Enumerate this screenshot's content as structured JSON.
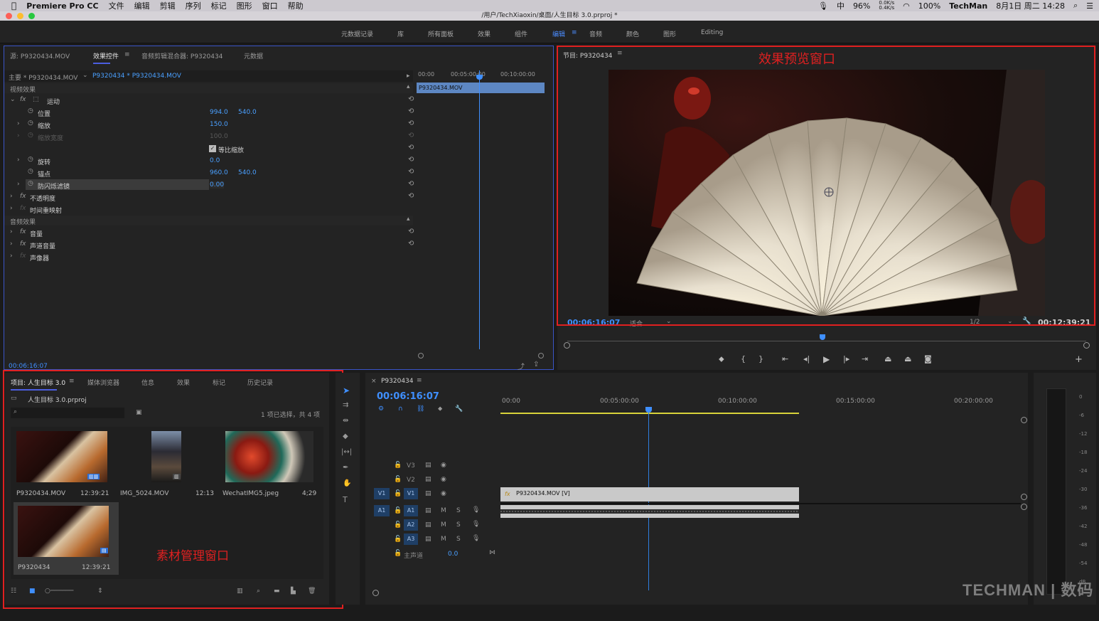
{
  "menubar": {
    "apple": "",
    "items": [
      "Premiere Pro CC",
      "文件",
      "编辑",
      "剪辑",
      "序列",
      "标记",
      "图形",
      "窗口",
      "帮助"
    ],
    "status": {
      "input": "中",
      "battery": "96%",
      "net_up": "0.0K/s",
      "net_down": "0.4K/s",
      "volume": "100%",
      "user": "TechMan",
      "datetime": "8月1日 周二 14:28"
    }
  },
  "titlebar": {
    "path": "/用户/TechXiaoxin/桌面/人生目标 3.0.prproj *"
  },
  "workspaces": [
    "元数据记录",
    "库",
    "所有面板",
    "效果",
    "组件",
    "编辑",
    "音频",
    "颜色",
    "图形",
    "Editing"
  ],
  "effect_controls": {
    "tabs": [
      "源: P9320434.MOV",
      "效果控件",
      "音频剪辑混合器: P9320434",
      "元数据"
    ],
    "header_left": "主要 * P9320434.MOV",
    "header_right": "P9320434 * P9320434.MOV",
    "mini_ruler": [
      "00:00",
      "00:05:00:00",
      "00:10:00:00"
    ],
    "mini_clip": "P9320434.MOV",
    "video_effects_label": "视频效果",
    "motion": "运动",
    "props": [
      {
        "name": "位置",
        "v1": "994.0",
        "v2": "540.0"
      },
      {
        "name": "缩放",
        "v1": "150.0",
        "v2": ""
      },
      {
        "name": "缩放宽度",
        "v1": "100.0",
        "v2": ""
      },
      {
        "name": "等比缩放",
        "v1": "",
        "v2": ""
      },
      {
        "name": "旋转",
        "v1": "0.0",
        "v2": ""
      },
      {
        "name": "锚点",
        "v1": "960.0",
        "v2": "540.0"
      },
      {
        "name": "防闪烁滤镜",
        "v1": "0.00",
        "v2": ""
      }
    ],
    "opacity": "不透明度",
    "time_remap": "时间重映射",
    "audio_effects_label": "音频效果",
    "audio_items": [
      "音量",
      "声道音量",
      "声像器"
    ],
    "timecode": "00:06:16:07"
  },
  "program_monitor": {
    "title": "节目: P9320434",
    "annotation": "效果预览窗口",
    "timecode": "00:06:16:07",
    "fit": "适合",
    "quality": "1/2",
    "duration": "00:12:39:21"
  },
  "project_panel": {
    "tabs": [
      "项目: 人生目标 3.0",
      "媒体浏览器",
      "信息",
      "效果",
      "标记",
      "历史记录"
    ],
    "project_file": "人生目标 3.0.prproj",
    "selection_info": "1 项已选择，共 4 项",
    "annotation": "素材管理窗口",
    "items": [
      {
        "name": "P9320434.MOV",
        "duration": "12:39:21"
      },
      {
        "name": "IMG_5024.MOV",
        "duration": "12:13"
      },
      {
        "name": "WechatIMG5.jpeg",
        "duration": "4;29"
      },
      {
        "name": "P9320434",
        "duration": "12:39:21"
      }
    ]
  },
  "timeline": {
    "title": "P9320434",
    "timecode": "00:06:16:07",
    "ruler": [
      "00:00",
      "00:05:00:00",
      "00:10:00:00",
      "00:15:00:00",
      "00:20:00:00"
    ],
    "tracks": [
      "V3",
      "V2",
      "V1",
      "A1",
      "A2",
      "A3"
    ],
    "src_v": "V1",
    "src_a": "A1",
    "master": "主声道",
    "master_val": "0.0",
    "clip_label": "P9320434.MOV [V]"
  },
  "meter_scale": [
    "0",
    "-6",
    "-12",
    "-18",
    "-24",
    "-30",
    "-36",
    "-42",
    "-48",
    "-54",
    "dB"
  ],
  "watermark": "TECHMAN | 数码",
  "colors": {
    "accent": "#3f8fff",
    "annotation": "#e02020",
    "clip_video": "#c9c9c9",
    "playhead": "#2f7fe0"
  }
}
